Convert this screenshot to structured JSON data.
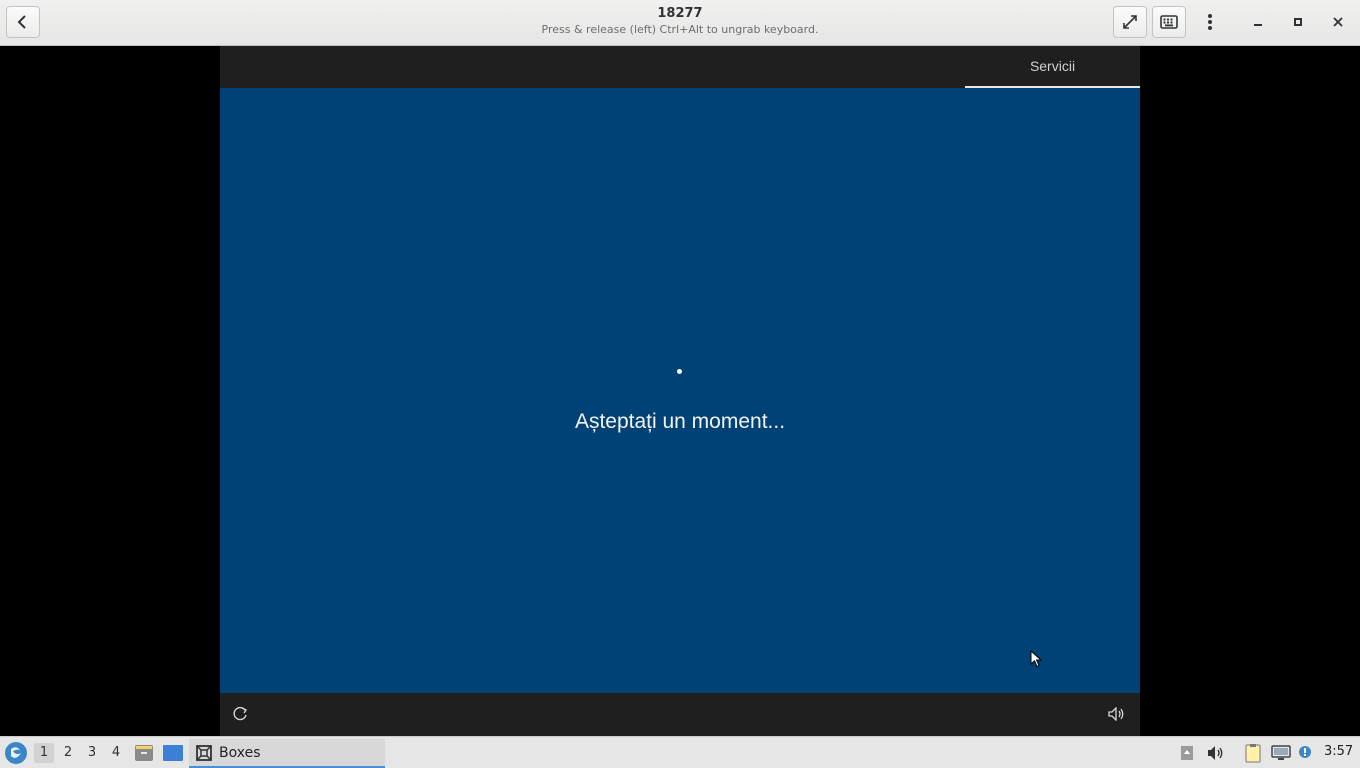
{
  "header": {
    "title": "18277",
    "subtitle": "Press & release (left) Ctrl+Alt to ungrab keyboard."
  },
  "vm": {
    "tab_label": "Servicii",
    "message": "Așteptați un moment...",
    "background_color": "#004275"
  },
  "taskbar": {
    "workspaces": [
      "1",
      "2",
      "3",
      "4"
    ],
    "active_workspace": "1",
    "task_label": "Boxes",
    "clock": "3:57"
  },
  "icons": {
    "back": "chevron-left-icon",
    "fullscreen": "fullscreen-icon",
    "keyboard": "keyboard-icon",
    "menu": "vertical-dots-icon",
    "minimize": "minimize-icon",
    "maximize": "maximize-icon",
    "close": "close-icon"
  }
}
